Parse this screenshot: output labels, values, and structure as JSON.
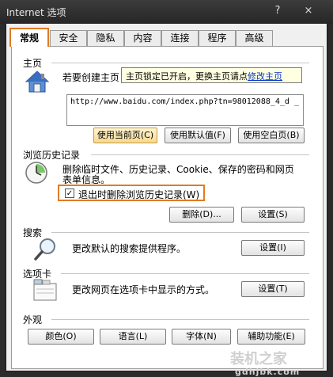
{
  "window": {
    "title": "Internet 选项",
    "help_glyph": "?",
    "close_glyph": "×"
  },
  "tabs": [
    {
      "label": "常规",
      "active": true
    },
    {
      "label": "安全"
    },
    {
      "label": "隐私"
    },
    {
      "label": "内容"
    },
    {
      "label": "连接"
    },
    {
      "label": "程序"
    },
    {
      "label": "高级"
    }
  ],
  "homepage": {
    "section_label": "主页",
    "description": "若要创建主页",
    "tooltip_text": "主页锁定已开启，更换主页请点",
    "tooltip_link": "修改主页",
    "url_value": "http://www.baidu.com/index.php?tn=98012088_4_d _",
    "buttons": [
      "使用当前页(C)",
      "使用默认值(F)",
      "使用空白页(B)"
    ]
  },
  "history": {
    "section_label": "浏览历史记录",
    "description_line1": "删除临时文件、历史记录、Cookie、保存的密码和网页",
    "description_line2": "表单信息。",
    "checkbox_label": "退出时删除浏览历史记录(W)",
    "checkbox_mark": "✓",
    "delete_button": "删除(D)...",
    "settings_button": "设置(S)"
  },
  "search": {
    "section_label": "搜索",
    "description": "更改默认的搜索提供程序。",
    "settings_button": "设置(I)"
  },
  "tabs_section": {
    "section_label": "选项卡",
    "description": "更改网页在选项卡中显示的方式。",
    "settings_button": "设置(T)"
  },
  "appearance": {
    "section_label": "外观",
    "buttons": [
      "颜色(O)",
      "语言(L)",
      "字体(N)",
      "辅助功能(E)"
    ]
  },
  "watermark": {
    "brand": "装机之家",
    "url": "gdhjbk.com"
  },
  "colors": {
    "highlight": "#e07b24",
    "link": "#0033cc",
    "tooltip_bg": "#ffffe1"
  }
}
